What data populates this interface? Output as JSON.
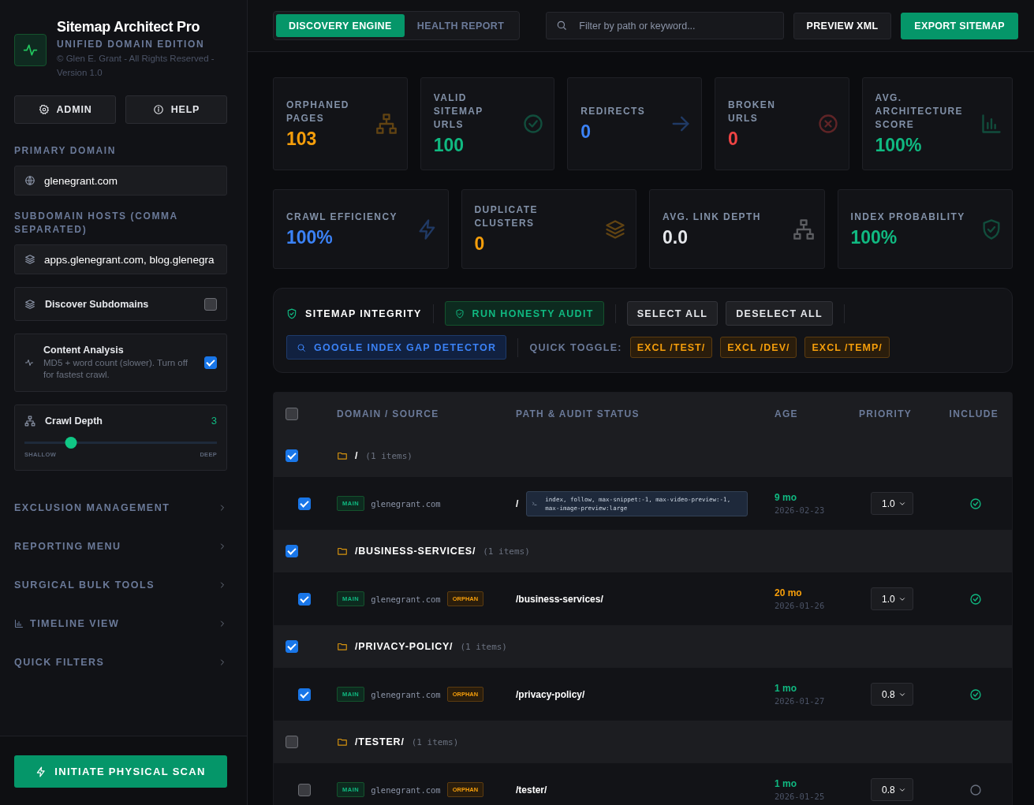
{
  "app": {
    "title": "Sitemap Architect Pro",
    "subtitle": "UNIFIED DOMAIN EDITION",
    "copyright": "© Glen E. Grant - All Rights Reserved - Version 1.0"
  },
  "sidebar": {
    "buttons": [
      "ADMIN",
      "HELP"
    ],
    "primary_domain": {
      "label": "PRIMARY DOMAIN",
      "value": "glenegrant.com"
    },
    "subdomain_hosts": {
      "label": "SUBDOMAIN HOSTS (COMMA SEPARATED)",
      "value": "apps.glenegrant.com, blog.glenegra"
    },
    "discover_subdomains": {
      "label": "Discover Subdomains",
      "checked": false
    },
    "content_analysis": {
      "label": "Content Analysis",
      "description": "MD5 + word count (slower). Turn off for fastest crawl.",
      "checked": true
    },
    "crawl_depth": {
      "label": "Crawl Depth",
      "reading": "3",
      "level": 0.24,
      "min_label": "SHALLOW",
      "max_label": "DEEP"
    },
    "nav": [
      {
        "label": "EXCLUSION MANAGEMENT",
        "kind": "plain"
      },
      {
        "label": "REPORTING MENU",
        "kind": "plain"
      },
      {
        "label": "SURGICAL BULK TOOLS",
        "kind": "plain"
      },
      {
        "label": "TIMELINE VIEW",
        "kind": "chart"
      },
      {
        "label": "QUICK FILTERS",
        "kind": "plain"
      }
    ],
    "scan_button": "INITIATE PHYSICAL SCAN"
  },
  "tabs": [
    {
      "label": "DISCOVERY ENGINE",
      "selected": true
    },
    {
      "label": "HEALTH REPORT",
      "selected": false
    }
  ],
  "search": {
    "placeholder": "Filter by path or keyword..."
  },
  "header_buttons": [
    {
      "label": "PREVIEW XML",
      "kind": "secondary"
    },
    {
      "label": "EXPORT SITEMAP",
      "kind": "primary"
    }
  ],
  "stats": [
    {
      "label": "ORPHANED PAGES",
      "value": "103",
      "color": "#f59e0b"
    },
    {
      "label": "VALID SITEMAP URLS",
      "value": "100",
      "color": "#10b981"
    },
    {
      "label": "REDIRECTS",
      "value": "0",
      "color": "#3b82f6"
    },
    {
      "label": "BROKEN URLS",
      "value": "0",
      "color": "#ef4444"
    },
    {
      "label": "AVG. ARCHITECTURE SCORE",
      "value": "100%",
      "color": "#10b981"
    }
  ],
  "metrics": [
    {
      "label": "CRAWL EFFICIENCY",
      "value": "100%",
      "color": "#3b82f6"
    },
    {
      "label": "DUPLICATE CLUSTERS",
      "value": "0",
      "color": "#f59e0b"
    },
    {
      "label": "AVG. LINK DEPTH",
      "value": "0.0",
      "color": "#e5e7eb"
    },
    {
      "label": "INDEX PROBABILITY",
      "value": "100%",
      "color": "#10b981"
    }
  ],
  "integrity": {
    "title": "SITEMAP INTEGRITY",
    "actions": [
      {
        "label": "RUN HONESTY AUDIT",
        "kind": "success"
      },
      {
        "label": "SELECT ALL",
        "kind": "neutral"
      },
      {
        "label": "DESELECT ALL",
        "kind": "neutral"
      }
    ],
    "detector": "GOOGLE INDEX GAP DETECTOR",
    "quick_toggle": {
      "label": "QUICK TOGGLE:",
      "filters": [
        "EXCL /TEST/",
        "EXCL /DEV/",
        "EXCL /TEMP/"
      ]
    }
  },
  "table": {
    "select_all_checked": false,
    "columns": [
      "DOMAIN / SOURCE",
      "PATH & AUDIT STATUS",
      "AGE",
      "PRIORITY",
      "INCLUDE"
    ],
    "groups": [
      {
        "checked": true,
        "path": "/",
        "count": "(1 items)",
        "items": [
          {
            "checked": true,
            "tag": "MAIN",
            "domain": "glenegrant.com",
            "path": "/",
            "robots": "index, follow, max-snippet:-1, max-video-preview:-1, max-image-preview:large",
            "age": {
              "text": "9 mo",
              "color": "#10b981"
            },
            "date": "2026-02-23",
            "priority": "1.0",
            "included": true
          }
        ]
      },
      {
        "checked": true,
        "path": "/BUSINESS-SERVICES/",
        "count": "(1 items)",
        "items": [
          {
            "checked": true,
            "tag": "MAIN",
            "domain": "glenegrant.com",
            "badge": "ORPHAN",
            "path": "/business-services/",
            "age": {
              "text": "20 mo",
              "color": "#f59e0b"
            },
            "date": "2026-01-26",
            "priority": "1.0",
            "included": true
          }
        ]
      },
      {
        "checked": true,
        "path": "/PRIVACY-POLICY/",
        "count": "(1 items)",
        "items": [
          {
            "checked": true,
            "tag": "MAIN",
            "domain": "glenegrant.com",
            "badge": "ORPHAN",
            "path": "/privacy-policy/",
            "age": {
              "text": "1 mo",
              "color": "#10b981"
            },
            "date": "2026-01-27",
            "priority": "0.8",
            "included": true
          }
        ]
      },
      {
        "checked": false,
        "path": "/TESTER/",
        "count": "(1 items)",
        "items": [
          {
            "checked": false,
            "tag": "MAIN",
            "domain": "glenegrant.com",
            "badge": "ORPHAN",
            "path": "/tester/",
            "age": {
              "text": "1 mo",
              "color": "#10b981"
            },
            "date": "2026-01-25",
            "priority": "0.8",
            "included": false
          }
        ]
      }
    ]
  }
}
